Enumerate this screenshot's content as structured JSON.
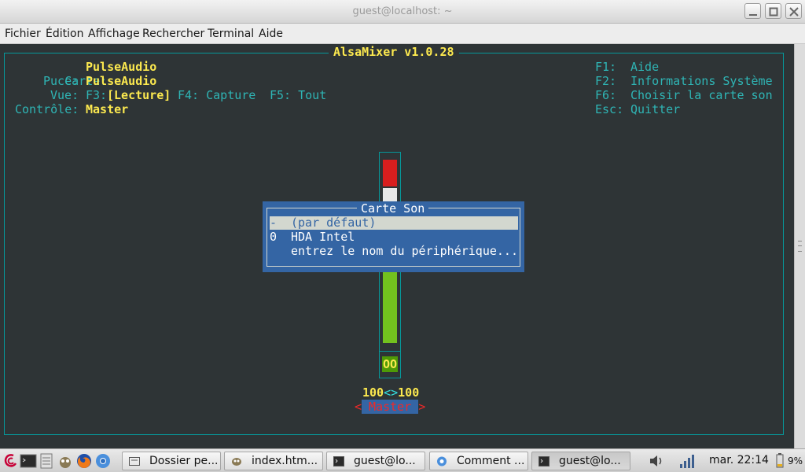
{
  "window": {
    "title": "guest@localhost: ~"
  },
  "menubar": [
    "Fichier",
    "Édition",
    "Affichage",
    "Rechercher",
    "Terminal",
    "Aide"
  ],
  "alsamixer": {
    "title": "AlsaMixer v1.0.28",
    "card_label": "Carte:",
    "card_value": "PulseAudio",
    "chip_label": "Puce:",
    "chip_value": "PulseAudio",
    "view_label": "Vue:",
    "view_f3": "F3:",
    "view_playback": "[Lecture]",
    "view_f4": "F4: Capture",
    "view_f5": "F5: Tout",
    "control_label": "Contrôle:",
    "control_value": "Master",
    "help": [
      {
        "key": "F1:",
        "text": "Aide"
      },
      {
        "key": "F2:",
        "text": "Informations Système"
      },
      {
        "key": "F6:",
        "text": "Choisir la carte son"
      },
      {
        "key": "Esc:",
        "text": "Quitter"
      }
    ],
    "mute_indicator": "OO",
    "volume_left": "100",
    "volume_sep": "<>",
    "volume_right": "100",
    "channel_open": "<",
    "channel_name": "Master",
    "channel_close": ">"
  },
  "dialog": {
    "title": "Carte Son",
    "items": [
      {
        "index": "-",
        "label": "(par défaut)",
        "selected": true
      },
      {
        "index": "0",
        "label": "HDA Intel",
        "selected": false
      },
      {
        "index": "",
        "label": "entrez le nom du périphérique...",
        "selected": false
      }
    ]
  },
  "taskbar": {
    "tasks": [
      {
        "label": "Dossier pe...",
        "icon": "folder-icon"
      },
      {
        "label": "index.htm...",
        "icon": "gimp-icon"
      },
      {
        "label": "guest@lo...",
        "icon": "terminal-icon"
      },
      {
        "label": "Comment ...",
        "icon": "chrome-icon"
      },
      {
        "label": "guest@lo...",
        "icon": "terminal-icon"
      }
    ],
    "clock": "mar. 22:14",
    "battery": "9%"
  },
  "colors": {
    "terminal_bg": "#2e3436",
    "cyan": "#06989a",
    "yellow": "#fce94f",
    "dialog_bg": "#3465a4",
    "volume_red": "#d81e1e",
    "volume_green": "#73c11e"
  }
}
